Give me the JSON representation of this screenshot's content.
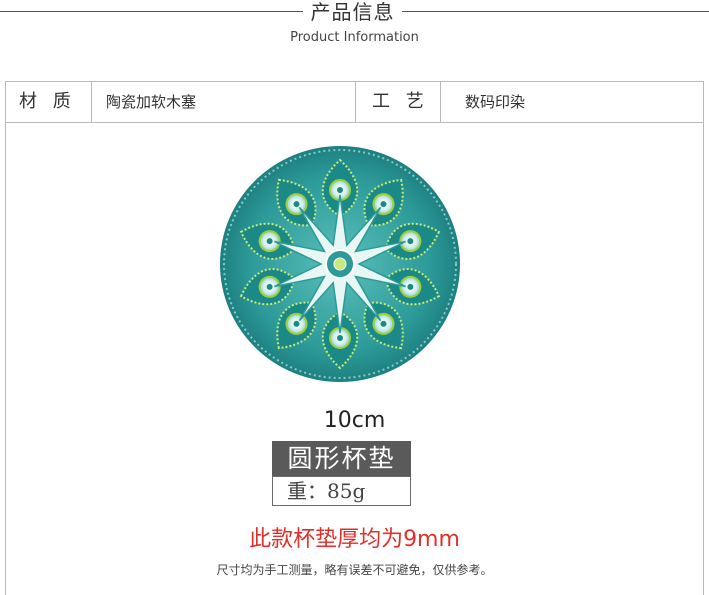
{
  "header": {
    "title": "产品信息",
    "subtitle": "Product Information"
  },
  "specs": {
    "material_label": "材 质",
    "material_value": "陶瓷加软木塞",
    "craft_label": "工 艺",
    "craft_value": "数码印染"
  },
  "product": {
    "size": "10cm",
    "name": "圆形杯垫",
    "weight": "重：85g"
  },
  "notes": {
    "thickness": "此款杯垫厚均为9mm",
    "disclaimer": "尺寸均为手工测量，略有误差不可避免，仅供参考。"
  },
  "colors": {
    "accent_red": "#e0302b",
    "label_bg": "#5a5a5a",
    "coaster_teal": "#2c9a98",
    "coaster_green": "#9ccf3b"
  }
}
